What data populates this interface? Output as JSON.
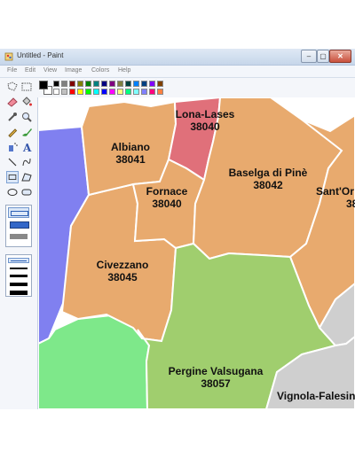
{
  "window": {
    "title": "Untitled - Paint",
    "buttons": [
      "–",
      "▢",
      "✕"
    ]
  },
  "menu": [
    "File",
    "Edit",
    "View",
    "Image",
    "Colors",
    "Help"
  ],
  "palette_colors": [
    "#000000",
    "#808080",
    "#800000",
    "#808000",
    "#008000",
    "#008080",
    "#000080",
    "#800080",
    "#808040",
    "#004040",
    "#0080ff",
    "#004080",
    "#8000ff",
    "#804000",
    "#ffffff",
    "#c0c0c0",
    "#ff0000",
    "#ffff00",
    "#00ff00",
    "#00ffff",
    "#0000ff",
    "#ff00ff",
    "#ffff80",
    "#00ff80",
    "#80ffff",
    "#8080ff",
    "#ff0080",
    "#ff8040"
  ],
  "primary_color": "#000000",
  "secondary_color": "#ffffff",
  "map": {
    "colors": {
      "orange": "#e8aa6e",
      "red": "#e0707a",
      "blue": "#8080f0",
      "green": "#a0ce6e",
      "light_green": "#7ee88a",
      "gray": "#cfcfcf"
    },
    "regions": [
      {
        "name": "Lona-Lases",
        "code": "38040"
      },
      {
        "name": "Albiano",
        "code": "38041"
      },
      {
        "name": "Fornace",
        "code": "38040"
      },
      {
        "name": "Baselga di Pinè",
        "code": "38042"
      },
      {
        "name": "Sant'Or",
        "code": "38"
      },
      {
        "name": "Civezzano",
        "code": "38045"
      },
      {
        "name": "Pergine Valsugana",
        "code": "38057"
      },
      {
        "name": "Vignola-Falesin",
        "code": ""
      }
    ]
  }
}
